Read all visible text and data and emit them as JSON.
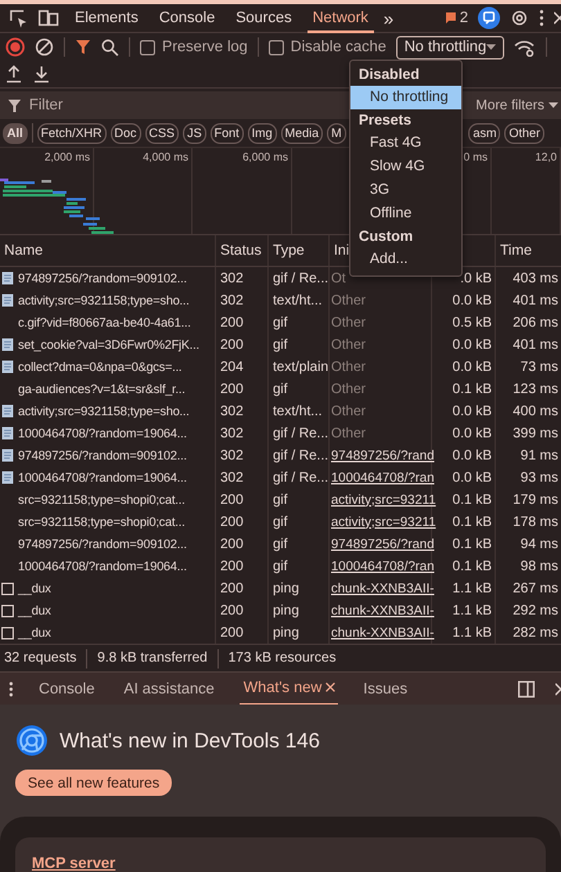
{
  "main_tabs": [
    {
      "label": "Elements",
      "selected": false
    },
    {
      "label": "Console",
      "selected": false
    },
    {
      "label": "Sources",
      "selected": false
    },
    {
      "label": "Network",
      "selected": true
    }
  ],
  "more_tabs": "»",
  "issues_badge": "2",
  "toolbar": {
    "checkboxes": [
      {
        "label": "Preserve log",
        "checked": false
      },
      {
        "label": "Disable cache",
        "checked": false
      }
    ],
    "throttling": {
      "value": "No throttling",
      "expanded": true,
      "menu": [
        {
          "header": "Disabled",
          "items": [
            {
              "label": "No throttling",
              "selected": true
            }
          ]
        },
        {
          "header": "Presets",
          "items": [
            {
              "label": "Fast 4G",
              "selected": false
            },
            {
              "label": "Slow 4G",
              "selected": false
            },
            {
              "label": "3G",
              "selected": false
            },
            {
              "label": "Offline",
              "selected": false
            }
          ]
        },
        {
          "header": "Custom",
          "items": [
            {
              "label": "Add...",
              "selected": false
            }
          ]
        }
      ]
    }
  },
  "filter": {
    "placeholder": "Filter",
    "more_filters": "More filters"
  },
  "type_chips": [
    {
      "label": "All",
      "selected": true
    },
    {
      "label": "Fetch/XHR",
      "selected": false
    },
    {
      "label": "Doc",
      "selected": false
    },
    {
      "label": "CSS",
      "selected": false
    },
    {
      "label": "JS",
      "selected": false
    },
    {
      "label": "Font",
      "selected": false
    },
    {
      "label": "Img",
      "selected": false
    },
    {
      "label": "Media",
      "selected": false
    },
    {
      "label": "M",
      "selected": false
    },
    {
      "label": "asm",
      "selected": false
    },
    {
      "label": "Other",
      "selected": false
    }
  ],
  "overview_ticks": [
    "2,000 ms",
    "4,000 ms",
    "6,000 ms",
    "0 ms",
    "12,0"
  ],
  "table": {
    "columns": [
      "Name",
      "Status",
      "Type",
      "Ini",
      "Time"
    ],
    "rows": [
      {
        "kind": "doc",
        "name": "974897256/?random=909102...",
        "status": "302",
        "type": "gif / Re...",
        "initiator": "Ot",
        "link": false,
        "size": ".0 kB",
        "time": "403 ms"
      },
      {
        "kind": "doc",
        "name": "activity;src=9321158;type=sho...",
        "status": "302",
        "type": "text/ht...",
        "initiator": "Other",
        "link": false,
        "size": "0.0 kB",
        "time": "401 ms"
      },
      {
        "kind": "none",
        "name": "c.gif?vid=f80667aa-be40-4a61...",
        "status": "200",
        "type": "gif",
        "initiator": "Other",
        "link": false,
        "size": "0.5 kB",
        "time": "206 ms"
      },
      {
        "kind": "doc",
        "name": "set_cookie?val=3D6Fwr0%2FjK...",
        "status": "200",
        "type": "gif",
        "initiator": "Other",
        "link": false,
        "size": "0.0 kB",
        "time": "401 ms"
      },
      {
        "kind": "doc",
        "name": "collect?dma=0&npa=0&gcs=...",
        "status": "204",
        "type": "text/plain",
        "initiator": "Other",
        "link": false,
        "size": "0.0 kB",
        "time": "73 ms"
      },
      {
        "kind": "none",
        "name": "ga-audiences?v=1&t=sr&slf_r...",
        "status": "200",
        "type": "gif",
        "initiator": "Other",
        "link": false,
        "size": "0.1 kB",
        "time": "123 ms"
      },
      {
        "kind": "doc",
        "name": "activity;src=9321158;type=sho...",
        "status": "302",
        "type": "text/ht...",
        "initiator": "Other",
        "link": false,
        "size": "0.0 kB",
        "time": "400 ms"
      },
      {
        "kind": "doc",
        "name": "1000464708/?random=19064...",
        "status": "302",
        "type": "gif / Re...",
        "initiator": "Other",
        "link": false,
        "size": "0.0 kB",
        "time": "399 ms"
      },
      {
        "kind": "doc",
        "name": "974897256/?random=909102...",
        "status": "302",
        "type": "gif / Re...",
        "initiator": "974897256/?rand",
        "link": true,
        "size": "0.0 kB",
        "time": "91 ms"
      },
      {
        "kind": "doc",
        "name": "1000464708/?random=19064...",
        "status": "302",
        "type": "gif / Re...",
        "initiator": "1000464708/?ran",
        "link": true,
        "size": "0.0 kB",
        "time": "93 ms"
      },
      {
        "kind": "none",
        "name": "src=9321158;type=shopi0;cat...",
        "status": "200",
        "type": "gif",
        "initiator": "activity;src=93211",
        "link": true,
        "size": "0.1 kB",
        "time": "179 ms"
      },
      {
        "kind": "none",
        "name": "src=9321158;type=shopi0;cat...",
        "status": "200",
        "type": "gif",
        "initiator": "activity;src=93211",
        "link": true,
        "size": "0.1 kB",
        "time": "178 ms"
      },
      {
        "kind": "none",
        "name": "974897256/?random=909102...",
        "status": "200",
        "type": "gif",
        "initiator": "974897256/?rand",
        "link": true,
        "size": "0.1 kB",
        "time": "94 ms"
      },
      {
        "kind": "none",
        "name": "1000464708/?random=19064...",
        "status": "200",
        "type": "gif",
        "initiator": "1000464708/?ran",
        "link": true,
        "size": "0.1 kB",
        "time": "98 ms"
      },
      {
        "kind": "ping",
        "name": "__dux",
        "status": "200",
        "type": "ping",
        "initiator": "chunk-XXNB3AII-",
        "link": true,
        "size": "1.1 kB",
        "time": "267 ms"
      },
      {
        "kind": "ping",
        "name": "__dux",
        "status": "200",
        "type": "ping",
        "initiator": "chunk-XXNB3AII-",
        "link": true,
        "size": "1.1 kB",
        "time": "292 ms"
      },
      {
        "kind": "ping",
        "name": "__dux",
        "status": "200",
        "type": "ping",
        "initiator": "chunk-XXNB3AII-",
        "link": true,
        "size": "1.1 kB",
        "time": "282 ms"
      }
    ]
  },
  "status_bar": [
    "32 requests",
    "9.8 kB transferred",
    "173 kB resources"
  ],
  "drawer_tabs": [
    {
      "label": "Console",
      "selected": false,
      "closable": false
    },
    {
      "label": "AI assistance",
      "selected": false,
      "closable": false
    },
    {
      "label": "What's new",
      "selected": true,
      "closable": true
    },
    {
      "label": "Issues",
      "selected": false,
      "closable": false
    }
  ],
  "whats_new": {
    "title": "What's new in DevTools 146",
    "button": "See all new features",
    "cards": [
      "MCP server"
    ]
  }
}
